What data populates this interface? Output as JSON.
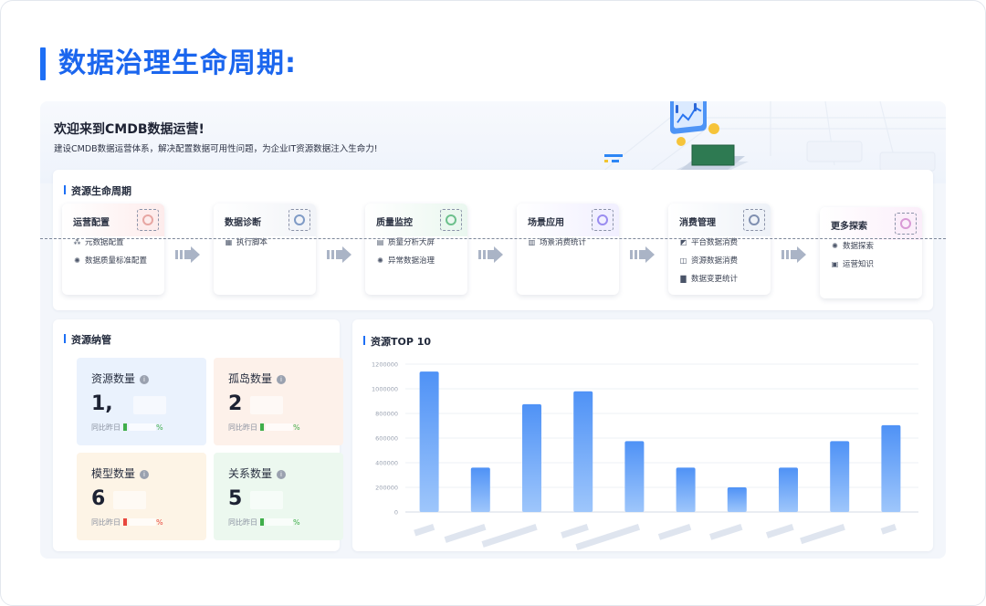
{
  "page_title": "数据治理生命周期:",
  "hero": {
    "title": "欢迎来到CMDB数据运营!",
    "subtitle": "建设CMDB数据运营体系，解决配置数据可用性问题，为企业IT资源数据注入生命力!"
  },
  "lifecycle": {
    "title": "资源生命周期",
    "stages": [
      {
        "name": "运营配置",
        "icon": "settings-icon",
        "items": [
          {
            "icon": "data-icon",
            "label": "元数据配置"
          },
          {
            "icon": "gear-icon",
            "label": "数据质量标准配置"
          }
        ]
      },
      {
        "name": "数据诊断",
        "icon": "diagnosis-icon",
        "items": [
          {
            "icon": "script-icon",
            "label": "执行脚本"
          }
        ]
      },
      {
        "name": "质量监控",
        "icon": "monitor-icon",
        "items": [
          {
            "icon": "screen-icon",
            "label": "质量分析大屏"
          },
          {
            "icon": "gear-icon",
            "label": "异常数据治理"
          }
        ]
      },
      {
        "name": "场景应用",
        "icon": "scene-icon",
        "items": [
          {
            "icon": "stats-icon",
            "label": "场景消费统计"
          }
        ]
      },
      {
        "name": "消费管理",
        "icon": "consume-icon",
        "items": [
          {
            "icon": "chart-icon",
            "label": "平台数据消费"
          },
          {
            "icon": "database-icon",
            "label": "资源数据消费"
          },
          {
            "icon": "bar-chart-icon",
            "label": "数据变更统计"
          }
        ]
      },
      {
        "name": "更多探索",
        "icon": "explore-icon",
        "items": [
          {
            "icon": "gear-icon",
            "label": "数据探索"
          },
          {
            "icon": "knowledge-icon",
            "label": "运营知识"
          }
        ]
      }
    ]
  },
  "resources": {
    "title": "资源纳管",
    "compare_label": "同比昨日",
    "percent": "%",
    "stats": [
      {
        "label": "资源数量",
        "value": "1,",
        "color": "#eaf2fd",
        "mark": "#3fae4a"
      },
      {
        "label": "孤岛数量",
        "value": "2",
        "color": "#fdf1ea",
        "mark": "#3fae4a"
      },
      {
        "label": "模型数量",
        "value": "6",
        "color": "#fdf4e6",
        "mark": "#e8473d"
      },
      {
        "label": "关系数量",
        "value": "5",
        "color": "#ecf8ef",
        "mark": "#3fae4a"
      }
    ]
  },
  "top10": {
    "title": "资源TOP 10"
  },
  "chart_data": {
    "type": "bar",
    "title": "资源TOP 10",
    "y_ticks": [
      "1200000",
      "1000000",
      "800000",
      "600000",
      "400000",
      "200000",
      "0"
    ],
    "ylim": [
      0,
      1200000
    ],
    "grid": true,
    "bar_color": "#5b9cf8",
    "values": [
      1140000,
      360000,
      875000,
      980000,
      575000,
      360000,
      200000,
      360000,
      575000,
      705000
    ]
  }
}
